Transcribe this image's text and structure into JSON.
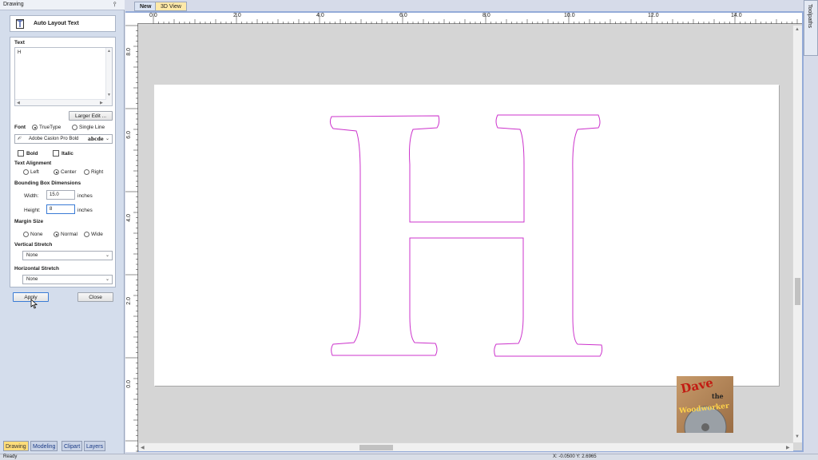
{
  "panel": {
    "title": "Drawing",
    "pin_icon": "pin-icon",
    "tool_title": "Auto Layout Text",
    "tool_icon": "text-layout-icon",
    "text_label": "Text",
    "text_value": "H",
    "larger_edit_label": "Larger Edit ...",
    "font_label": "Font",
    "font_type_options": [
      "TrueType",
      "Single Line"
    ],
    "font_type_selected": "TrueType",
    "font_name": "Adobe Caslon Pro Bold",
    "font_preview": "abcde",
    "bold_label": "Bold",
    "italic_label": "Italic",
    "alignment_label": "Text Alignment",
    "alignment_options": [
      "Left",
      "Center",
      "Right"
    ],
    "alignment_selected": "Center",
    "bbox_label": "Bounding Box Dimensions",
    "width_label": "Width:",
    "width_value": "15.0",
    "height_label": "Height:",
    "height_value": "8",
    "units": "inches",
    "margin_label": "Margin Size",
    "margin_options": [
      "None",
      "Normal",
      "Wide"
    ],
    "margin_selected": "Normal",
    "vstretch_label": "Vertical Stretch",
    "vstretch_value": "None",
    "hstretch_label": "Horizontal Stretch",
    "hstretch_value": "None",
    "apply_label": "Apply",
    "close_label": "Close"
  },
  "bottom_tabs": [
    "Drawing",
    "Modeling",
    "Clipart",
    "Layers"
  ],
  "active_bottom_tab": "Drawing",
  "doc_tabs": [
    "New",
    "3D View"
  ],
  "active_doc_tab": "New",
  "right_tab": "Toolpaths",
  "ruler": {
    "h_labels": [
      "0.0",
      "2.0",
      "4.0",
      "6.0",
      "8.0",
      "10.0",
      "12.0",
      "14.0"
    ],
    "v_labels": [
      "8.0",
      "6.0",
      "4.0",
      "2.0",
      "0.0"
    ]
  },
  "canvas": {
    "glyph": "H",
    "outline_color": "#cc33cc"
  },
  "logo": {
    "line1": "Dave",
    "line2": "the",
    "line3": "Woodworker"
  },
  "status": {
    "text": "Ready",
    "coords": "X: -0.0500 Y: 2.6965"
  },
  "colors": {
    "panel_bg": "#d4ddec",
    "active_tab": "#ffdd7a",
    "frame": "#94abd8"
  }
}
